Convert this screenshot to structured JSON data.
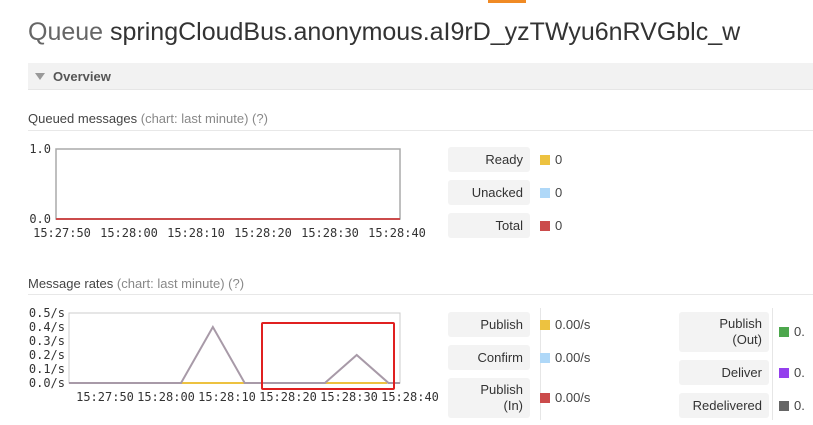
{
  "title": {
    "prefix": "Queue",
    "name": "springCloudBus.anonymous.aI9rD_yzTWyu6nRVGblc_w"
  },
  "overview": {
    "label": "Overview"
  },
  "queued": {
    "heading": "Queued messages",
    "chart_note": "(chart: last minute)",
    "help": "(?)",
    "stats": [
      {
        "label": "Ready",
        "value": "0",
        "color": "#edc240"
      },
      {
        "label": "Unacked",
        "value": "0",
        "color": "#afd8f8"
      },
      {
        "label": "Total",
        "value": "0",
        "color": "#cb4b4b"
      }
    ]
  },
  "rates": {
    "heading": "Message rates",
    "chart_note": "(chart: last minute)",
    "help": "(?)",
    "left_stats": [
      {
        "label": "Publish",
        "value": "0.00/s",
        "color": "#edc240"
      },
      {
        "label": "Confirm",
        "value": "0.00/s",
        "color": "#afd8f8"
      },
      {
        "label": "Publish\n(In)",
        "value": "0.00/s",
        "color": "#cb4b4b"
      }
    ],
    "right_stats": [
      {
        "label": "Publish\n(Out)",
        "value": "0.",
        "color": "#4da74d"
      },
      {
        "label": "Deliver",
        "value": "0.",
        "color": "#9440ed"
      },
      {
        "label": "Redelivered",
        "value": "0.",
        "color": "#666666"
      }
    ]
  },
  "chart_data": [
    {
      "type": "line",
      "name": "queued-messages",
      "x": [
        "15:27:50",
        "15:28:00",
        "15:28:10",
        "15:28:20",
        "15:28:30",
        "15:28:40"
      ],
      "ylim": [
        0,
        1.0
      ],
      "yticks": [
        "1.0",
        "0.0"
      ],
      "series": [
        {
          "name": "Total",
          "color": "#cb4b4b",
          "values": [
            0,
            0,
            0,
            0,
            0,
            0
          ]
        }
      ]
    },
    {
      "type": "line",
      "name": "message-rates",
      "x": [
        "15:27:50",
        "15:28:00",
        "15:28:10",
        "15:28:20",
        "15:28:30",
        "15:28:40"
      ],
      "ylim": [
        0,
        0.5
      ],
      "yticks": [
        "0.5/s",
        "0.4/s",
        "0.3/s",
        "0.2/s",
        "0.1/s",
        "0.0/s"
      ],
      "series": [
        {
          "name": "Publish",
          "color": "#edc240",
          "points": [
            [
              0,
              0
            ],
            [
              50,
              0
            ]
          ]
        },
        {
          "name": "Deliver",
          "color": "#a89aa8",
          "points": [
            [
              0,
              0
            ],
            [
              17.6,
              0
            ],
            [
              22.6,
              0.4
            ],
            [
              27.6,
              0
            ],
            [
              40.2,
              0
            ],
            [
              45.2,
              0.2
            ],
            [
              50.2,
              0
            ],
            [
              52,
              0
            ]
          ]
        }
      ]
    }
  ]
}
